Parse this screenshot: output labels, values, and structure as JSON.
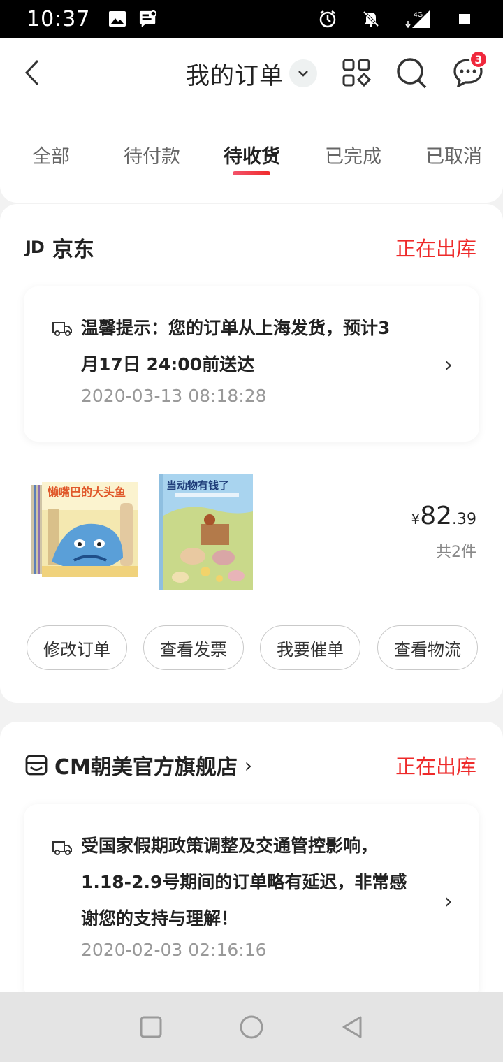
{
  "status_bar": {
    "time": "10:37",
    "network": "4G"
  },
  "header": {
    "title": "我的订单",
    "message_badge": "3"
  },
  "tabs": [
    {
      "label": "全部",
      "active": false
    },
    {
      "label": "待付款",
      "active": false
    },
    {
      "label": "待收货",
      "active": true
    },
    {
      "label": "已完成",
      "active": false
    },
    {
      "label": "已取消",
      "active": false
    }
  ],
  "orders": [
    {
      "shop_logo": "JD",
      "shop_name": "京东",
      "status": "正在出库",
      "notice": {
        "line1": "温馨提示：您的订单从上海发货，预计3",
        "line2": "月17日 24:00前送达",
        "timestamp": "2020-03-13 08:18:28"
      },
      "products": [
        {
          "title": "懒嘴巴的大头鱼"
        },
        {
          "title": "当动物有钱了"
        }
      ],
      "price": {
        "currency": "¥",
        "integer": "82",
        "decimal": ".39"
      },
      "item_count": "共2件",
      "actions": [
        "修改订单",
        "查看发票",
        "我要催单",
        "查看物流"
      ]
    },
    {
      "shop_name": "CM朝美官方旗舰店",
      "shop_arrow": "›",
      "status": "正在出库",
      "notice": {
        "line1": "受国家假期政策调整及交通管控影响，",
        "line2": "1.18-2.9号期间的订单略有延迟，非常感",
        "line3": "谢您的支持与理解！",
        "timestamp": "2020-02-03 02:16:16"
      }
    }
  ],
  "colors": {
    "accent_red": "#ee2a2a",
    "badge_red": "#f0283c",
    "text_dark": "#222222",
    "text_gray": "#999999"
  },
  "icons": {
    "status_left": [
      "image-icon",
      "message-notification-icon"
    ],
    "status_right": [
      "alarm-icon",
      "notifications-off-icon",
      "signal-icon",
      "battery-icon"
    ],
    "header": [
      "back-arrow-icon",
      "chevron-down-icon",
      "grid-apps-icon",
      "search-icon",
      "chat-bubble-icon"
    ],
    "nav": [
      "recents-square-icon",
      "home-circle-icon",
      "back-triangle-icon"
    ]
  }
}
